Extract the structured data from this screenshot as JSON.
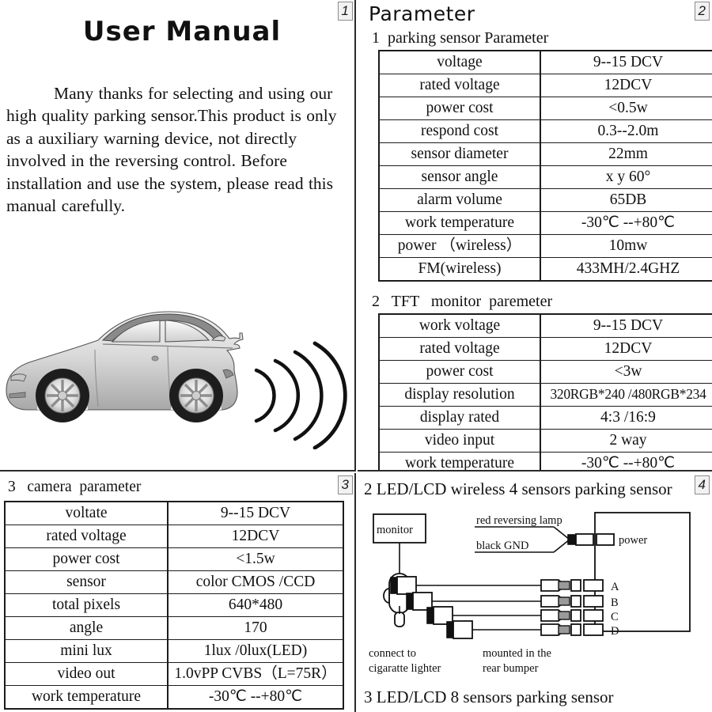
{
  "document": {
    "title": "User Manual",
    "intro": "Many  thanks for selecting and  using our high quality parking sensor.This product is only as a auxiliary warning device, not directly involved in the reversing control.    Before installation and use the system, please read this manual carefully."
  },
  "pages": {
    "p1_number": "1",
    "p2_number": "2",
    "p3_number": "3",
    "p4_number": "4"
  },
  "page1": {
    "illustration_name": "car-with-parking-sensor-waves"
  },
  "page2": {
    "sheet_title": "Parameter",
    "section1": {
      "heading": "1  parking sensor Parameter",
      "rows": [
        {
          "key": "voltage",
          "value": "9--15 DCV"
        },
        {
          "key": "rated voltage",
          "value": "12DCV"
        },
        {
          "key": "power cost",
          "value": "<0.5w"
        },
        {
          "key": "respond cost",
          "value": "0.3--2.0m"
        },
        {
          "key": "sensor diameter",
          "value": "22mm"
        },
        {
          "key": "sensor  angle",
          "value": "x  y  60°"
        },
        {
          "key": "alarm volume",
          "value": "65DB"
        },
        {
          "key": "work temperature",
          "value": "-30℃ --+80℃"
        },
        {
          "key": "power （wireless）",
          "value": "10mw"
        },
        {
          "key": "FM(wireless)",
          "value": "433MH/2.4GHZ"
        }
      ]
    },
    "section2": {
      "heading": "2   TFT   monitor  paremeter",
      "rows": [
        {
          "key": "work   voltage",
          "value": "9--15 DCV"
        },
        {
          "key": "rated   voltage",
          "value": "12DCV"
        },
        {
          "key": "power   cost",
          "value": "<3w"
        },
        {
          "key": "display resolution",
          "value": "320RGB*240 /480RGB*234"
        },
        {
          "key": "display rated",
          "value": "4:3  /16:9"
        },
        {
          "key": "video  input",
          "value": "2   way"
        },
        {
          "key": "work   temperature",
          "value": "-30℃ --+80℃"
        }
      ]
    }
  },
  "page3": {
    "section3": {
      "heading": "3   camera  parameter",
      "rows": [
        {
          "key": "voltate",
          "value": "9--15 DCV"
        },
        {
          "key": "rated voltage",
          "value": "12DCV"
        },
        {
          "key": "power  cost",
          "value": "<1.5w"
        },
        {
          "key": "sensor",
          "value": "color  CMOS /CCD"
        },
        {
          "key": "total  pixels",
          "value": "640*480"
        },
        {
          "key": "angle",
          "value": "170"
        },
        {
          "key": "mini  lux",
          "value": "1lux /0lux(LED)"
        },
        {
          "key": "video out",
          "value": "1.0vPP CVBS（L=75R）"
        },
        {
          "key": "work  temperature",
          "value": "-30℃ --+80℃"
        }
      ]
    }
  },
  "page4": {
    "heading": "2 LED/LCD wireless 4 sensors parking sensor",
    "footer_heading": "3 LED/LCD 8 sensors parking sensor",
    "labels": {
      "monitor": "monitor",
      "connect_to_line1": "connect to",
      "connect_to_line2": "cigaratte lighter",
      "red_lamp": "red  reversing  lamp",
      "black_gnd": "black    GND",
      "power": "power",
      "mounted_line1": "mounted  in  the",
      "mounted_line2": "rear bumper",
      "sensor_a": "A",
      "sensor_b": "B",
      "sensor_c": "C",
      "sensor_d": "D"
    }
  }
}
